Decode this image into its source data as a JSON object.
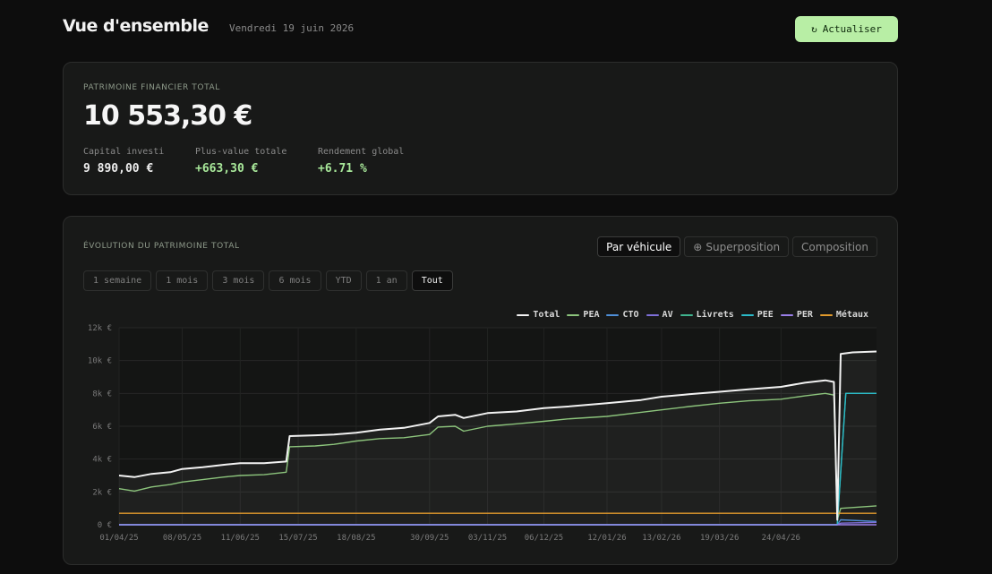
{
  "header": {
    "title": "Vue d'ensemble",
    "date": "Vendredi 19 juin 2026",
    "refresh_icon": "↻",
    "refresh_label": "Actualiser"
  },
  "summary": {
    "total_label": "PATRIMOINE FINANCIER TOTAL",
    "total_value": "10 553,30 €",
    "stats": [
      {
        "label": "Capital investi",
        "value": "9 890,00 €"
      },
      {
        "label": "Plus-value totale",
        "value": "+663,30 €"
      },
      {
        "label": "Rendement global",
        "value": "+6.71 %"
      }
    ]
  },
  "chart_panel": {
    "title": "ÉVOLUTION DU PATRIMOINE TOTAL",
    "views": [
      {
        "label": "Par véhicule",
        "icon": "",
        "active": true
      },
      {
        "label": "Superposition",
        "icon": "⊕",
        "active": false
      },
      {
        "label": "Composition",
        "icon": "",
        "active": false
      }
    ],
    "ranges": [
      {
        "label": "1 semaine",
        "active": false
      },
      {
        "label": "1 mois",
        "active": false
      },
      {
        "label": "3 mois",
        "active": false
      },
      {
        "label": "6 mois",
        "active": false
      },
      {
        "label": "YTD",
        "active": false
      },
      {
        "label": "1 an",
        "active": false
      },
      {
        "label": "Tout",
        "active": true
      }
    ]
  },
  "chart_data": {
    "type": "line",
    "title": "",
    "xlabel": "",
    "ylabel": "",
    "ylim": [
      0,
      12000
    ],
    "yticks": [
      0,
      2000,
      4000,
      6000,
      8000,
      10000,
      12000
    ],
    "ytick_labels": [
      "0 €",
      "2k €",
      "4k €",
      "6k €",
      "8k €",
      "10k €",
      "12k €"
    ],
    "xlim": [
      "2025-04-01",
      "2026-06-19"
    ],
    "xticks": [
      "2025-04-01",
      "2025-05-08",
      "2025-06-11",
      "2025-07-15",
      "2025-08-18",
      "2025-09-30",
      "2025-11-03",
      "2025-12-06",
      "2026-01-12",
      "2026-02-13",
      "2026-03-19",
      "2026-04-24"
    ],
    "xtick_labels": [
      "01/04/25",
      "08/05/25",
      "11/06/25",
      "15/07/25",
      "18/08/25",
      "30/09/25",
      "03/11/25",
      "06/12/25",
      "12/01/26",
      "13/02/26",
      "19/03/26",
      "24/04/26"
    ],
    "grid": true,
    "legend_position": "top-right",
    "series": [
      {
        "name": "Total",
        "color": "#f2f2f2",
        "width": 2,
        "points": [
          [
            "2025-04-01",
            3000
          ],
          [
            "2025-04-10",
            2900
          ],
          [
            "2025-04-20",
            3100
          ],
          [
            "2025-05-01",
            3200
          ],
          [
            "2025-05-08",
            3400
          ],
          [
            "2025-05-20",
            3500
          ],
          [
            "2025-06-01",
            3650
          ],
          [
            "2025-06-11",
            3750
          ],
          [
            "2025-06-25",
            3750
          ],
          [
            "2025-07-08",
            3850
          ],
          [
            "2025-07-10",
            5400
          ],
          [
            "2025-07-25",
            5450
          ],
          [
            "2025-08-05",
            5500
          ],
          [
            "2025-08-18",
            5600
          ],
          [
            "2025-09-01",
            5800
          ],
          [
            "2025-09-15",
            5900
          ],
          [
            "2025-09-30",
            6200
          ],
          [
            "2025-10-05",
            6600
          ],
          [
            "2025-10-15",
            6700
          ],
          [
            "2025-10-20",
            6500
          ],
          [
            "2025-11-03",
            6800
          ],
          [
            "2025-11-20",
            6900
          ],
          [
            "2025-12-06",
            7100
          ],
          [
            "2025-12-20",
            7200
          ],
          [
            "2026-01-12",
            7400
          ],
          [
            "2026-02-01",
            7600
          ],
          [
            "2026-02-13",
            7800
          ],
          [
            "2026-03-01",
            7950
          ],
          [
            "2026-03-19",
            8100
          ],
          [
            "2026-04-05",
            8250
          ],
          [
            "2026-04-24",
            8400
          ],
          [
            "2026-05-08",
            8650
          ],
          [
            "2026-05-20",
            8800
          ],
          [
            "2026-05-25",
            8700
          ],
          [
            "2026-05-27",
            300
          ],
          [
            "2026-05-29",
            10400
          ],
          [
            "2026-06-05",
            10500
          ],
          [
            "2026-06-19",
            10553
          ]
        ]
      },
      {
        "name": "PEA",
        "color": "#8cc47c",
        "width": 1.4,
        "points": [
          [
            "2025-04-01",
            2200
          ],
          [
            "2025-04-10",
            2050
          ],
          [
            "2025-04-20",
            2300
          ],
          [
            "2025-05-01",
            2450
          ],
          [
            "2025-05-08",
            2600
          ],
          [
            "2025-05-20",
            2750
          ],
          [
            "2025-06-01",
            2900
          ],
          [
            "2025-06-11",
            3000
          ],
          [
            "2025-06-25",
            3050
          ],
          [
            "2025-07-08",
            3200
          ],
          [
            "2025-07-10",
            4750
          ],
          [
            "2025-07-25",
            4800
          ],
          [
            "2025-08-05",
            4900
          ],
          [
            "2025-08-18",
            5100
          ],
          [
            "2025-09-01",
            5250
          ],
          [
            "2025-09-15",
            5300
          ],
          [
            "2025-09-30",
            5500
          ],
          [
            "2025-10-05",
            5950
          ],
          [
            "2025-10-15",
            6000
          ],
          [
            "2025-10-20",
            5700
          ],
          [
            "2025-11-03",
            6000
          ],
          [
            "2025-11-20",
            6150
          ],
          [
            "2025-12-06",
            6300
          ],
          [
            "2025-12-20",
            6450
          ],
          [
            "2026-01-12",
            6600
          ],
          [
            "2026-02-01",
            6850
          ],
          [
            "2026-02-13",
            7000
          ],
          [
            "2026-03-01",
            7200
          ],
          [
            "2026-03-19",
            7400
          ],
          [
            "2026-04-05",
            7550
          ],
          [
            "2026-04-24",
            7650
          ],
          [
            "2026-05-08",
            7850
          ],
          [
            "2026-05-20",
            8000
          ],
          [
            "2026-05-25",
            7900
          ],
          [
            "2026-05-27",
            300
          ],
          [
            "2026-05-29",
            1000
          ],
          [
            "2026-06-19",
            1150
          ]
        ]
      },
      {
        "name": "CTO",
        "color": "#4f8fd8",
        "width": 1.4,
        "points": [
          [
            "2025-04-01",
            0
          ],
          [
            "2026-05-27",
            0
          ],
          [
            "2026-05-29",
            300
          ],
          [
            "2026-06-19",
            200
          ]
        ]
      },
      {
        "name": "AV",
        "color": "#7e6fd8",
        "width": 1.4,
        "points": [
          [
            "2025-04-01",
            0
          ],
          [
            "2026-05-27",
            0
          ],
          [
            "2026-05-29",
            100
          ],
          [
            "2026-06-19",
            150
          ]
        ]
      },
      {
        "name": "Livrets",
        "color": "#3fb48e",
        "width": 1.4,
        "points": [
          [
            "2025-04-01",
            0
          ],
          [
            "2026-05-27",
            0
          ],
          [
            "2026-06-01",
            8000
          ],
          [
            "2026-06-19",
            8000
          ]
        ]
      },
      {
        "name": "PEE",
        "color": "#2bbac8",
        "width": 1.4,
        "points": [
          [
            "2025-04-01",
            0
          ],
          [
            "2026-05-27",
            0
          ],
          [
            "2026-06-01",
            8000
          ],
          [
            "2026-06-19",
            8000
          ]
        ]
      },
      {
        "name": "PER",
        "color": "#9a7ee8",
        "width": 1.4,
        "points": [
          [
            "2025-04-01",
            0
          ],
          [
            "2026-06-19",
            0
          ]
        ]
      },
      {
        "name": "Métaux",
        "color": "#e29a2c",
        "width": 1.4,
        "points": [
          [
            "2025-04-01",
            700
          ],
          [
            "2026-06-19",
            700
          ]
        ]
      }
    ]
  }
}
